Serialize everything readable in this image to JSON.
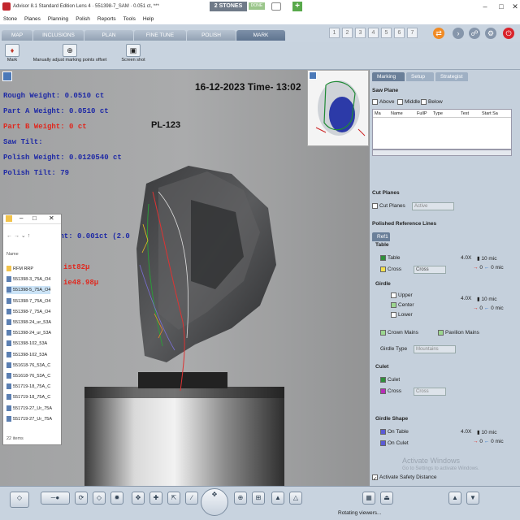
{
  "titlebar": {
    "title": "Advisor 8.1 Standard Edition Lens 4 · 551398-7_SAM · 0.051 ct, ***",
    "stones": "2 STONES",
    "done": "DONE"
  },
  "menu": [
    "Stone",
    "Planes",
    "Planning",
    "Polish",
    "Reports",
    "Tools",
    "Help"
  ],
  "tabs": [
    "MAP",
    "INCLUSIONS",
    "PLAN",
    "FINE TUNE",
    "POLISH",
    "MARK"
  ],
  "active_tab": "MARK",
  "stone_numbers": [
    "1",
    "2",
    "3",
    "4",
    "5",
    "6",
    "7"
  ],
  "toolbar": {
    "mark_label": "Mark",
    "adjust_label": "Manually adjust marking points offset",
    "screenshot_label": "Screen shot"
  },
  "overlay": {
    "datetime": "16-12-2023 Time- 13:02",
    "rough_weight": "Rough Weight: 0.0510 ct",
    "part_a": "Part A Weight: 0.0510 ct",
    "part_b": "Part B Weight: 0 ct",
    "saw_tilt": "Saw Tilt:",
    "polish_weight": "Polish Weight: 0.0120540 ct",
    "polish_tilt": "Polish Tilt: 79",
    "pl_label": "PL-123",
    "partial_weight": "ght: 0.001ct (2.0",
    "partial_red1": "ist82µ",
    "partial_red2": "ie48.98µ"
  },
  "explorer": {
    "header": "Name",
    "items": [
      "RFM RRP",
      "551398-3_75A_O4",
      "551398-5_75A_O4",
      "551398-7_75A_O4",
      "551398-7_75A_O4",
      "551398-24_ur_53A",
      "551398-24_ur_53A",
      "551398-102_53A",
      "551398-102_53A",
      "551618-76_53A_C",
      "551618-76_53A_C",
      "551719-18_75A_C",
      "551719-18_75A_C",
      "551719-27_Ur_75A",
      "551719-27_Ur_75A"
    ],
    "count": "22 items"
  },
  "right_panel": {
    "tabs": [
      "Marking",
      "Setup",
      "Strategist"
    ],
    "saw_plane": "Saw Plane",
    "above": "Above",
    "middle": "Middle",
    "below": "Below",
    "table_headers": [
      "Ma",
      "Name",
      "FullP",
      "Type",
      "Test",
      "Start Sa"
    ],
    "cut_planes": "Cut Planes",
    "cut_planes_cb": "Cut Planes",
    "active_select": "Active",
    "polished_ref": "Polished Reference Lines",
    "ref_tab": "Ref1",
    "table_section": "Table",
    "table_cb": "Table",
    "cross_cb": "Cross",
    "cross_select": "Cross",
    "zoom1": "4.0X",
    "mic1": "10 mic",
    "zero1": "0 mic",
    "girdle_section": "Girdle",
    "upper": "Upper",
    "center": "Center",
    "lower": "Lower",
    "zoom2": "4.0X",
    "mic2": "10 mic",
    "zero2": "0 mic",
    "crown_mains": "Crown Mains",
    "pavilion_mains": "Pavilion Mains",
    "girdle_type": "Girdle Type",
    "mountains": "Mountains",
    "culet_section": "Culet",
    "culet_cb": "Culet",
    "culet_cross": "Cross",
    "culet_cross_select": "Cross",
    "girdle_shape": "Girdle Shape",
    "on_table": "On Table",
    "on_culet": "On Culet",
    "zoom3": "4.0X",
    "mic3": "10 mic",
    "zero3": "0 mic",
    "activate_windows": "Activate Windows",
    "activate_sub": "Go to Settings to activate Windows.",
    "safety": "Activate Safety Distance"
  },
  "status": {
    "rotating": "Rotating viewers..."
  },
  "colors": {
    "accent": "#6a7f99",
    "red_text": "#e0281e",
    "blue_text": "#1f2aa5"
  }
}
